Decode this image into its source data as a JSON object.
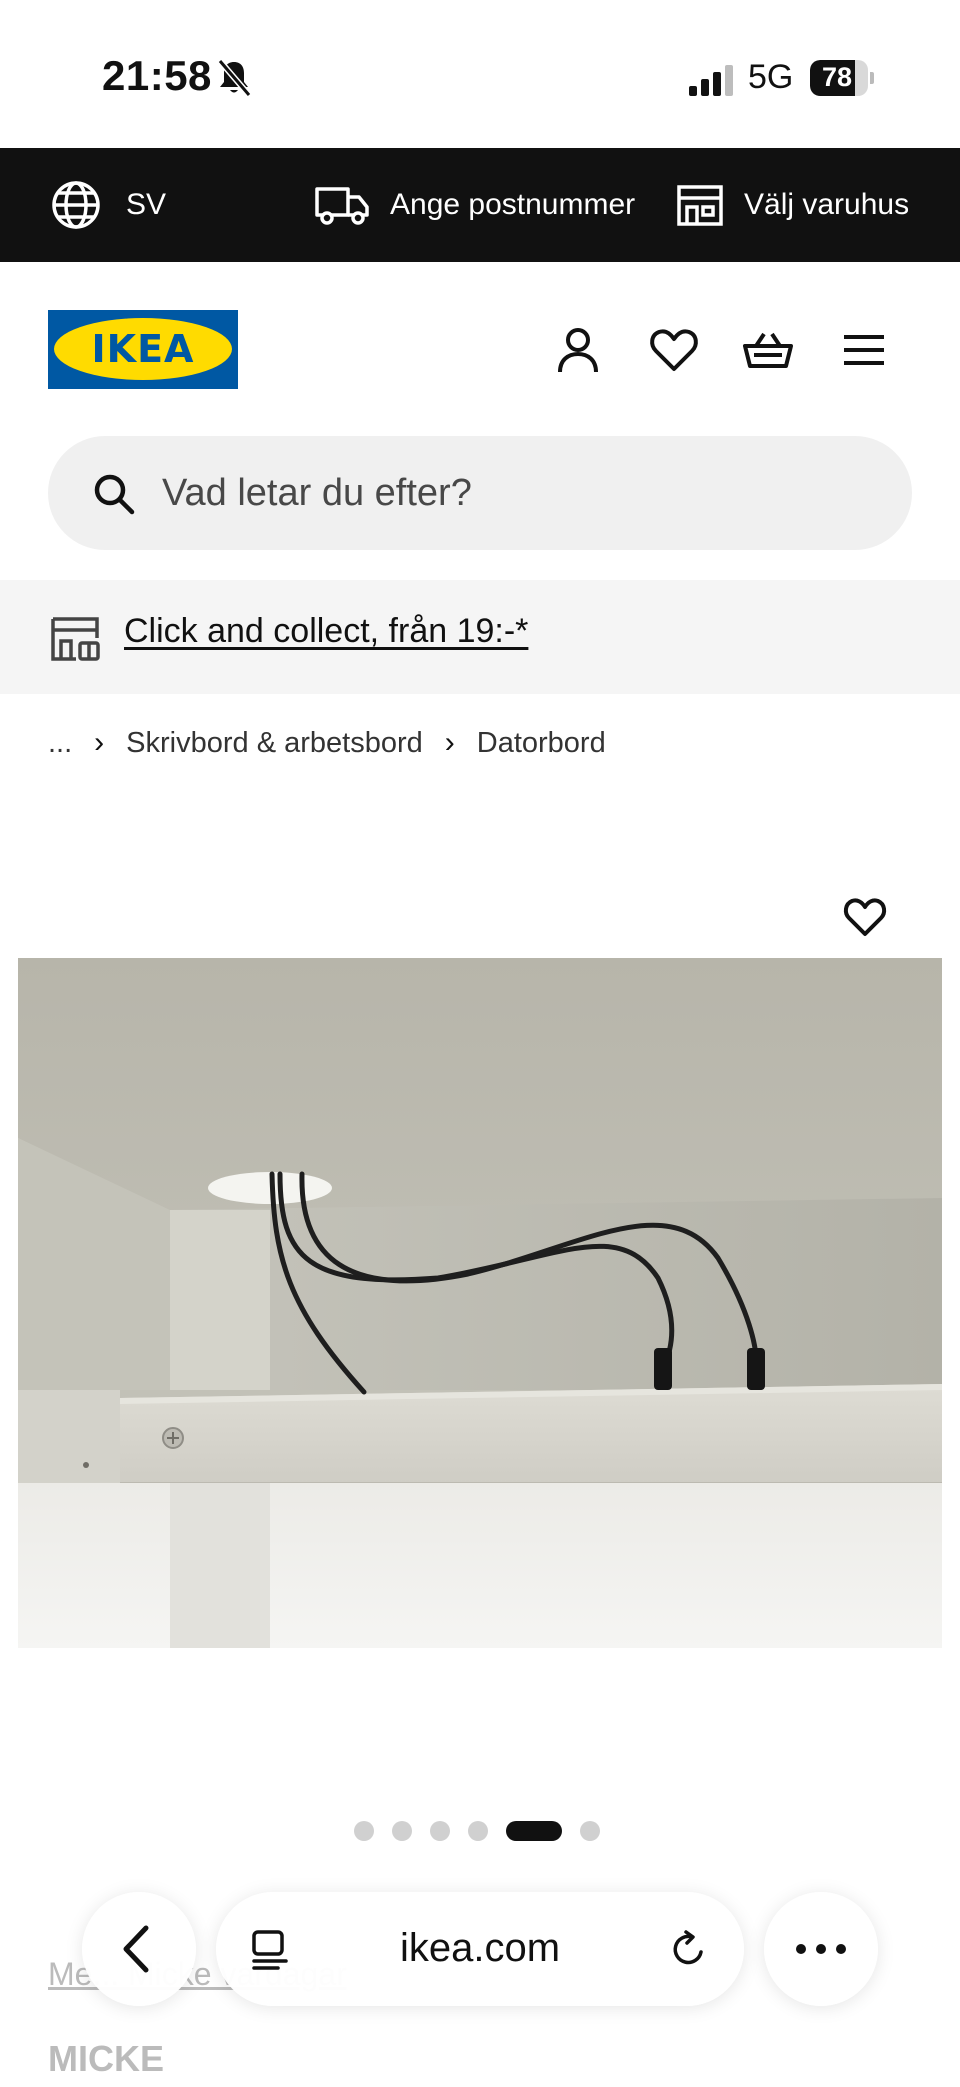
{
  "status_bar": {
    "time": "21:58",
    "network": "5G",
    "battery": "78",
    "battery_level": 0.78
  },
  "topbar": {
    "language": "SV",
    "zip_label": "Ange postnummer",
    "store_label": "Välj varuhus"
  },
  "header": {
    "logo_text": "IKEA",
    "icons": [
      "profile-icon",
      "heart-icon",
      "basket-icon",
      "menu-icon"
    ]
  },
  "search": {
    "placeholder": "Vad letar du efter?",
    "value": ""
  },
  "promo": {
    "link": "Click and collect, från 19:-*"
  },
  "breadcrumb": {
    "items": [
      "...",
      "Skrivbord & arbetsbord",
      "Datorbord"
    ]
  },
  "gallery": {
    "slide_count": 6,
    "active_index": 4
  },
  "product": {
    "series": "Me... Micke vardagar",
    "name": "MICKE"
  },
  "browser": {
    "url": "ikea.com"
  },
  "colors": {
    "topbar_bg": "#111111",
    "logo_blue": "#0058a3",
    "logo_yellow": "#ffdb00",
    "search_bg": "#f0f0f0",
    "promo_bg": "#f5f5f5"
  }
}
